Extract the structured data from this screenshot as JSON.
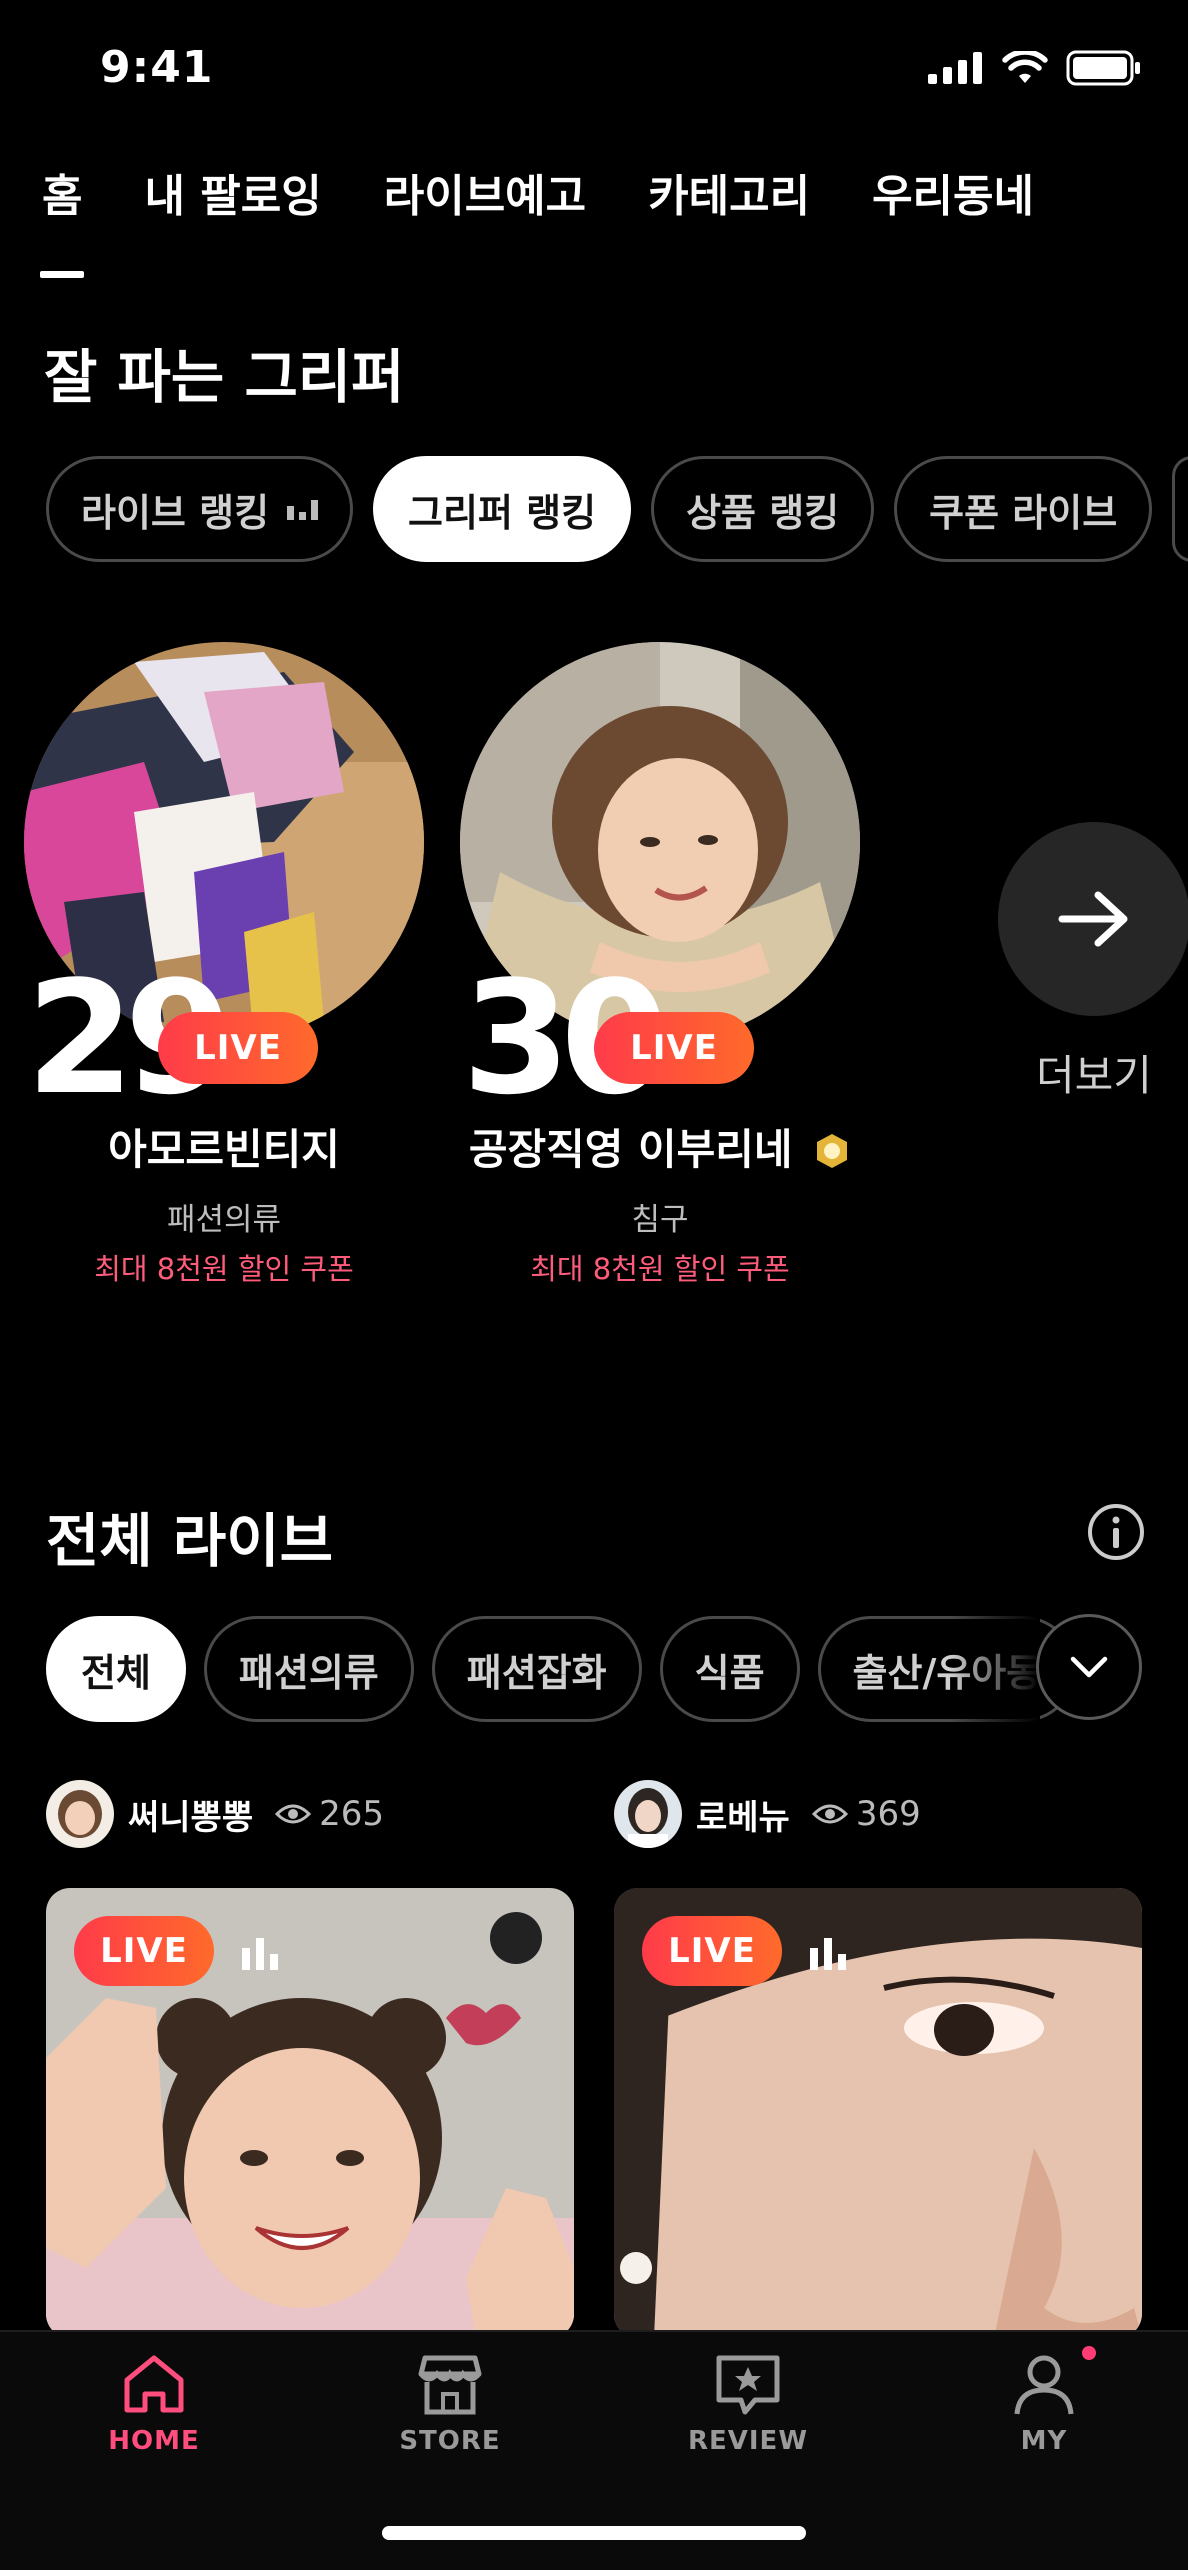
{
  "status": {
    "time": "9:41"
  },
  "tabs": [
    "홈",
    "내 팔로잉",
    "라이브예고",
    "카테고리",
    "우리동네"
  ],
  "ranking": {
    "title": "잘 파는 그리퍼",
    "chips": [
      "라이브 랭킹",
      "그리퍼 랭킹",
      "상품 랭킹",
      "쿠폰 라이브"
    ],
    "active_chip": "그리퍼 랭킹",
    "cards": [
      {
        "rank": "29",
        "live_label": "LIVE",
        "name": "아모르빈티지",
        "category": "패션의류",
        "coupon": "최대 8천원 할인 쿠폰"
      },
      {
        "rank": "30",
        "live_label": "LIVE",
        "name": "공장직영 이부리네",
        "category": "침구",
        "coupon": "최대 8천원 할인 쿠폰"
      }
    ],
    "more_label": "더보기"
  },
  "all_live": {
    "title": "전체 라이브",
    "categories": [
      "전체",
      "패션의류",
      "패션잡화",
      "식품",
      "출산/유아동"
    ],
    "active_category": "전체",
    "streams": [
      {
        "host": "써니뽕뽕",
        "views": "265",
        "live_label": "LIVE"
      },
      {
        "host": "로베뉴",
        "views": "369",
        "live_label": "LIVE"
      }
    ]
  },
  "bottom_nav": [
    "HOME",
    "STORE",
    "REVIEW",
    "MY"
  ],
  "colors": {
    "accent": "#ff4d7d",
    "live_start": "#ff3b4a",
    "live_end": "#ff6a2b",
    "coupon": "#ff5b7a"
  }
}
